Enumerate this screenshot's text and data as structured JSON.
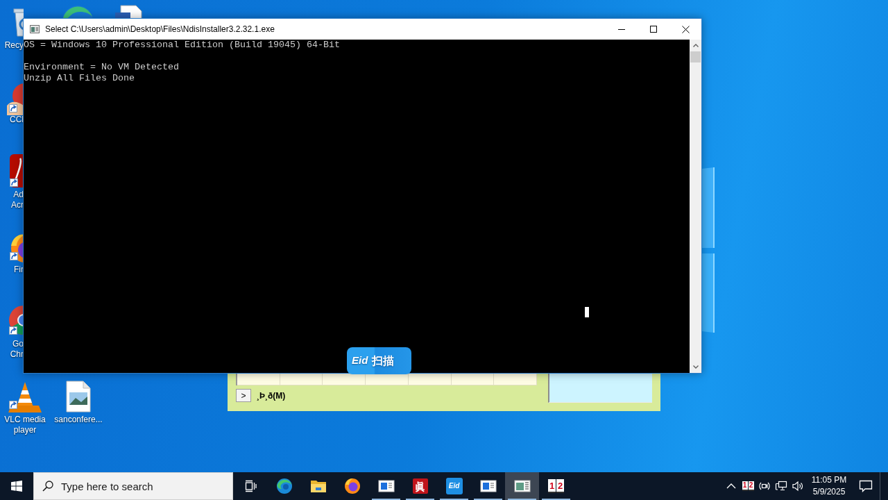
{
  "desktop": {
    "icons": [
      {
        "kind": "recycle-bin",
        "shortcut": false,
        "label_lines": [
          "Recy"
        ]
      },
      {
        "kind": "edge"
      },
      {
        "kind": "word-doc"
      },
      {
        "kind": "ccleaner",
        "shortcut": true,
        "label_lines": [
          "CCl"
        ]
      },
      {
        "kind": "acrobat",
        "shortcut": true,
        "label_lines": [
          "Ad",
          "Acr"
        ]
      },
      {
        "kind": "firefox",
        "shortcut": true,
        "label_lines": [
          "Fir"
        ]
      },
      {
        "kind": "chrome",
        "shortcut": true,
        "label_lines": [
          "Go",
          "Chr"
        ]
      },
      {
        "kind": "vlc",
        "shortcut": true,
        "label_lines": [
          "VLC media",
          "player"
        ]
      },
      {
        "kind": "image-file",
        "shortcut": false,
        "label_lines": [
          "sanconfere..."
        ]
      }
    ]
  },
  "console_window": {
    "title": "Select C:\\Users\\admin\\Desktop\\Files\\NdisInstaller3.2.32.1.exe",
    "output_blocks": [
      [
        "OS = Windows 10 Professional Edition (Build 19045) 64-Bit"
      ],
      [
        "Environment = No VM Detected",
        "Unzip All Files Done"
      ]
    ]
  },
  "background_window": {
    "expand_button": ">",
    "label": "¸Þ¸ð(M)"
  },
  "scan_button": {
    "logo": "Eid",
    "label": "扫描"
  },
  "taskbar": {
    "search": {
      "placeholder": "Type here to search"
    },
    "buttons": [
      {
        "kind": "task-view",
        "running": false,
        "selected": false
      },
      {
        "kind": "edge",
        "running": false,
        "selected": false
      },
      {
        "kind": "folder",
        "running": false,
        "selected": false
      },
      {
        "kind": "firefox",
        "running": false,
        "selected": false
      },
      {
        "kind": "window",
        "running": true,
        "selected": false
      },
      {
        "kind": "glyph",
        "glyph": "眞",
        "running": true,
        "selected": false
      },
      {
        "kind": "eid",
        "glyph": "Eid",
        "running": true,
        "selected": false
      },
      {
        "kind": "window",
        "running": true,
        "selected": false
      },
      {
        "kind": "console",
        "running": true,
        "selected": true
      },
      {
        "kind": "calendar",
        "digits": [
          "1",
          "2"
        ],
        "running": true,
        "selected": false
      }
    ],
    "tray": [
      {
        "kind": "chevron"
      },
      {
        "kind": "calendar",
        "digits": [
          "1",
          "2"
        ]
      },
      {
        "kind": "camera"
      },
      {
        "kind": "network"
      },
      {
        "kind": "volume"
      }
    ],
    "clock": {
      "time": "11:05 PM",
      "date": "5/9/2025"
    }
  }
}
